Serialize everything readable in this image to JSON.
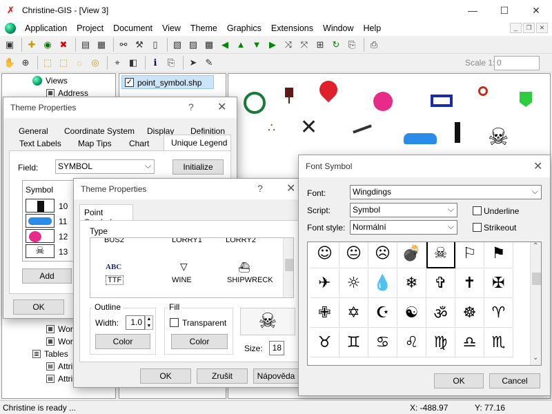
{
  "app": {
    "title": "Christine-GIS - [View 3]"
  },
  "window_controls": {
    "minimize": "—",
    "maximize": "☐",
    "close": "✕"
  },
  "menu": [
    "Application",
    "Project",
    "Document",
    "View",
    "Theme",
    "Graphics",
    "Extensions",
    "Window",
    "Help"
  ],
  "mdi": {
    "min": "_",
    "restore": "❐",
    "close": "✕"
  },
  "scale": {
    "label": "Scale 1:",
    "value": "0"
  },
  "tree": {
    "views": "Views",
    "address": "Address",
    "tables": "Tables",
    "items": [
      "Wor",
      "Wor",
      "Attri",
      "Attri"
    ]
  },
  "layer": {
    "name": "point_symbol.shp",
    "checked": true
  },
  "status": {
    "left": "Christine is ready ...",
    "x": "X: -488.97",
    "y": "Y: 77.16"
  },
  "theme_dialog": {
    "title": "Theme Properties",
    "help": "?",
    "close": "✕",
    "tabs_row1": [
      "General",
      "Coordinate System",
      "Display",
      "Definition"
    ],
    "tabs_row2": [
      "Text Labels",
      "Map Tips",
      "Chart",
      "Unique Legend"
    ],
    "field_label": "Field:",
    "field_value": "SYMBOL",
    "initialize": "Initialize",
    "table_header": "Symbol",
    "rows": [
      "10",
      "11",
      "12",
      "13"
    ],
    "add": "Add",
    "ok": "OK"
  },
  "point_dialog": {
    "title": "Theme Properties",
    "help": "?",
    "close": "✕",
    "tab": "Point Symbol",
    "type_label": "Type",
    "type_row1": [
      "BUS2",
      "LORRY1",
      "LORRY2"
    ],
    "ttf_sample": "ABC",
    "type_row2": [
      "TTF",
      "WINE",
      "SHIPWRECK"
    ],
    "outline_label": "Outline",
    "width_label": "Width:",
    "width_value": "1.0",
    "color_btn": "Color",
    "fill_label": "Fill",
    "transparent_label": "Transparent",
    "fill_color_btn": "Color",
    "size_label": "Size:",
    "size_value": "18",
    "ok": "OK",
    "cancel": "Zrušit",
    "help_btn": "Nápověda"
  },
  "font_dialog": {
    "title": "Font Symbol",
    "close": "✕",
    "font_label": "Font:",
    "font_value": "Wingdings",
    "script_label": "Script:",
    "script_value": "Symbol",
    "style_label": "Font style:",
    "style_value": "Normální",
    "underline_label": "Underline",
    "strikeout_label": "Strikeout",
    "glyphs": [
      "☺",
      "😐",
      "☹",
      "💣",
      "☠",
      "⚐",
      "⚑",
      "✈",
      "☼",
      "💧",
      "❄",
      "✞",
      "✝",
      "✠",
      "✙",
      "✡",
      "☪",
      "☯",
      "ॐ",
      "☸",
      "♈",
      "♉",
      "♊",
      "♋",
      "♌",
      "♍",
      "♎",
      "♏"
    ],
    "ok": "OK",
    "cancel": "Cancel"
  },
  "map_symbols": {
    "skull": "☠",
    "dots": "∴",
    "windmill": "✕"
  },
  "colors": {
    "accent": "#0078d7",
    "pin": "#e0202a",
    "bomb": "#e82b8a",
    "car": "#2b8be8",
    "flag_green": "#2ecc40",
    "icon_brown": "#8a4a1a"
  }
}
